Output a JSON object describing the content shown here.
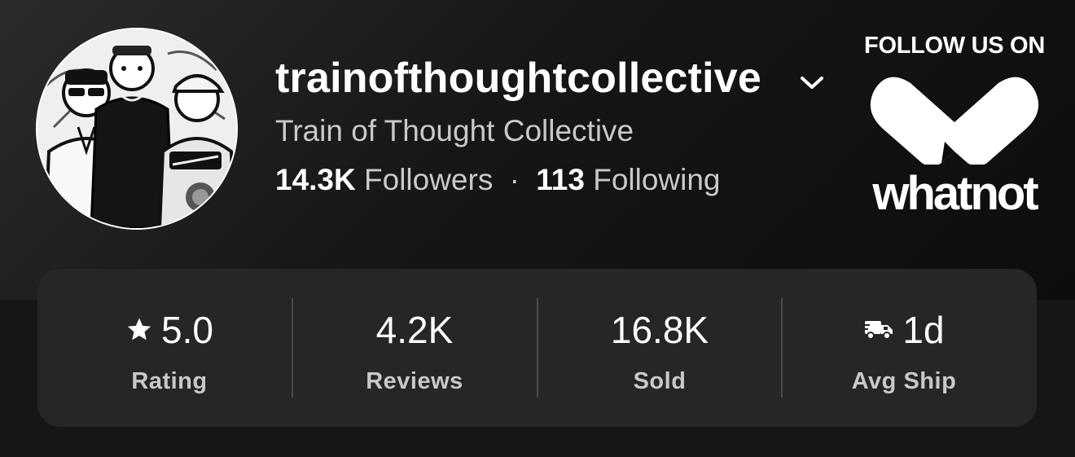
{
  "profile": {
    "username": "trainofthoughtcollective",
    "display_name": "Train of Thought Collective",
    "followers_count": "14.3K",
    "followers_label": "Followers",
    "separator": "·",
    "following_count": "113",
    "following_label": "Following",
    "avatar_icon": "group-portrait-avatar",
    "menu_icon": "chevron-down-icon"
  },
  "promo": {
    "title": "FOLLOW US ON",
    "brand": "whatnot",
    "logo_icon": "whatnot-logo-icon"
  },
  "stats": [
    {
      "value": "5.0",
      "label": "Rating",
      "icon": "star-icon"
    },
    {
      "value": "4.2K",
      "label": "Reviews"
    },
    {
      "value": "16.8K",
      "label": "Sold"
    },
    {
      "value": "1d",
      "label": "Avg Ship",
      "icon": "truck-icon"
    }
  ],
  "colors": {
    "background": "#161616",
    "card": "#262626",
    "text_primary": "#ffffff",
    "text_secondary": "#c9c9c9"
  }
}
